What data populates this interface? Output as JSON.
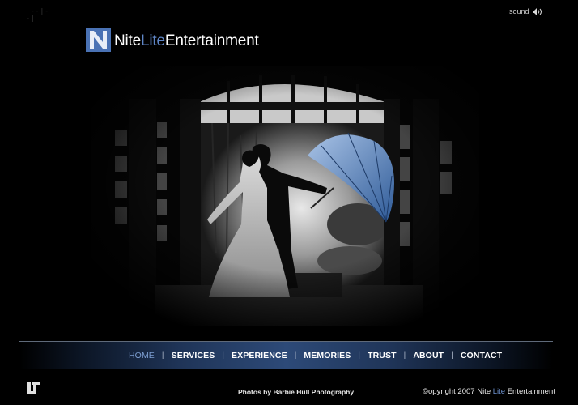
{
  "loader": {
    "glyph": "|--|--|"
  },
  "sound": {
    "label": "sound",
    "icon": "speaker-icon"
  },
  "brand": {
    "name_part1": "Nite",
    "name_part2": "Lite",
    "name_part3": "Entertainment",
    "accent_color": "#5f86c7",
    "logo_icon": "nl-monogram-icon"
  },
  "hero": {
    "description_icon": "wedding-couple-umbrella-photo"
  },
  "nav": {
    "items": [
      {
        "label": "HOME",
        "active": true
      },
      {
        "label": "SERVICES"
      },
      {
        "label": "EXPERIENCE"
      },
      {
        "label": "MEMORIES"
      },
      {
        "label": "TRUST"
      },
      {
        "label": "ABOUT"
      },
      {
        "label": "CONTACT"
      }
    ],
    "separator": "|"
  },
  "footer": {
    "mark_icon": "l-bracket-logo-icon",
    "credit": "Photos by Barbie Hull Photography",
    "copyright_prefix": "©opyright 2007 Nite ",
    "copyright_accent": "Lite",
    "copyright_suffix": " Entertainment"
  }
}
